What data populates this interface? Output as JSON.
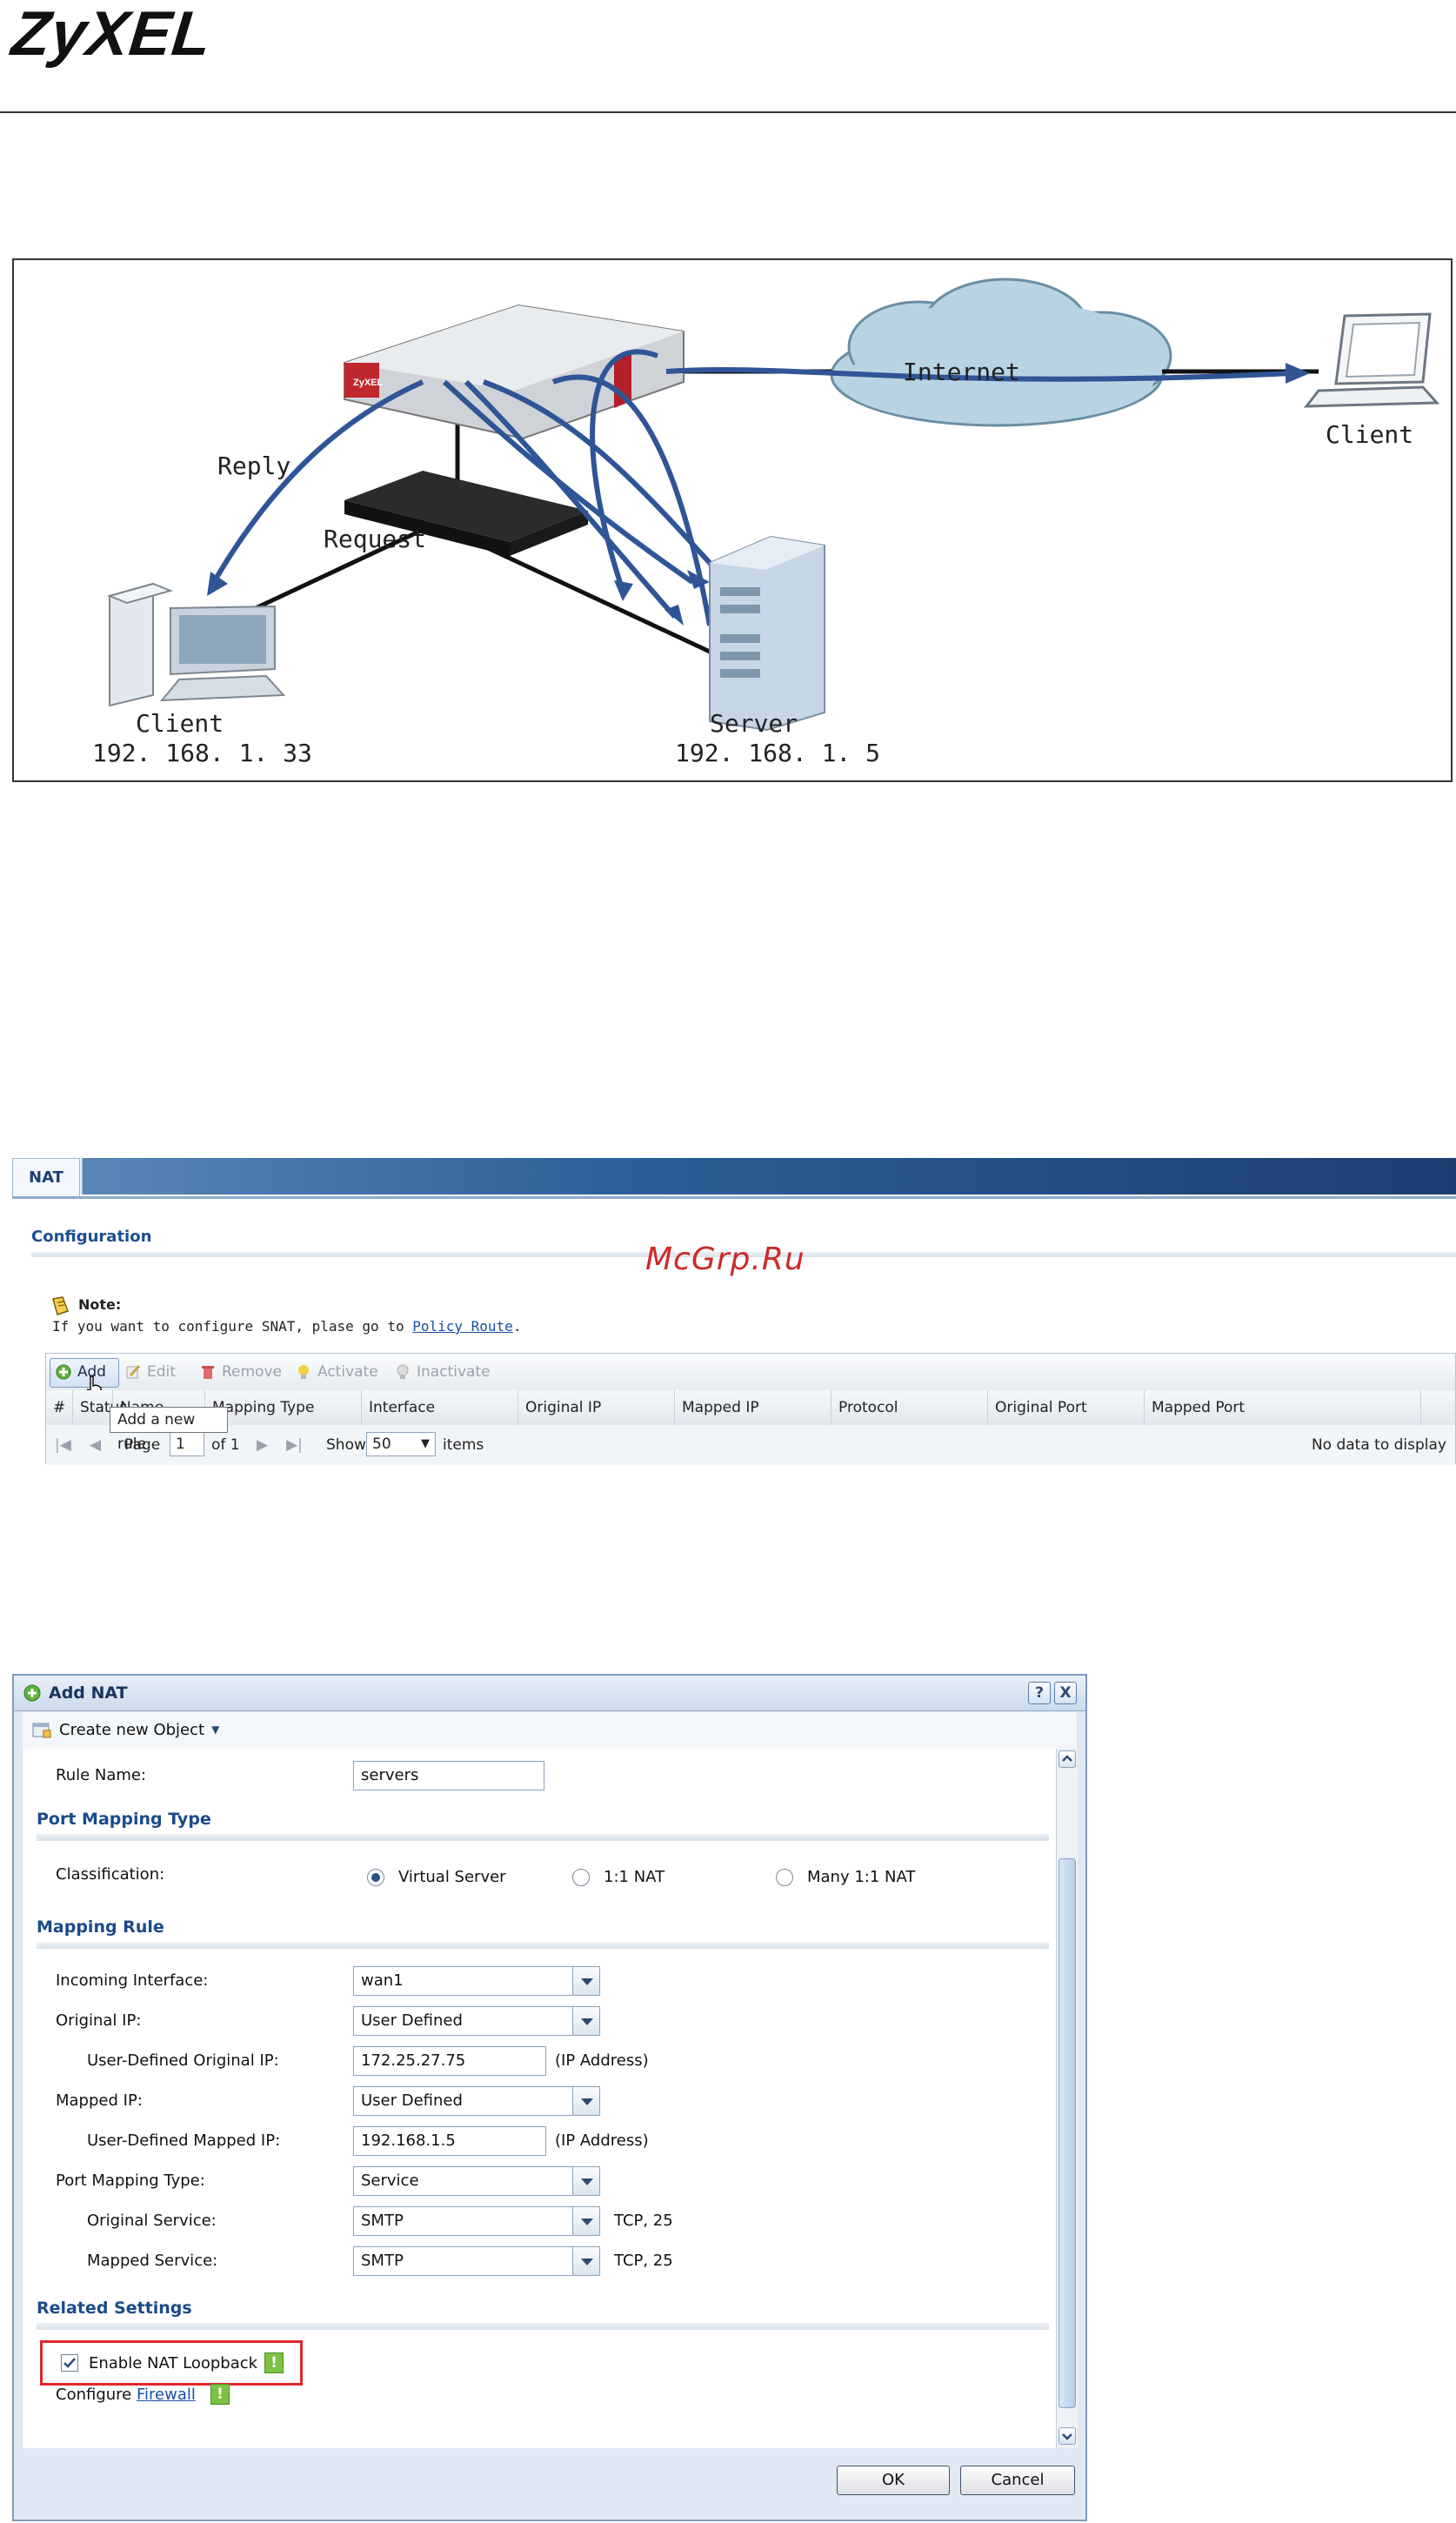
{
  "header": {
    "logo": "ZyXEL"
  },
  "diagram": {
    "labels": {
      "internet": "Internet",
      "remote_client": "Client",
      "reply": "Reply",
      "request": "Request",
      "local_client": "Client",
      "local_client_ip": "192. 168. 1. 33",
      "server": "Server",
      "server_ip": "192. 168. 1. 5"
    }
  },
  "watermark": "McGrp.Ru",
  "nat_panel": {
    "tab": "NAT",
    "section": "Configuration",
    "note_title": "Note:",
    "note_text": "If you want to configure SNAT, plase go to ",
    "note_link": "Policy Route",
    "note_end": ".",
    "toolbar": {
      "add": "Add",
      "edit": "Edit",
      "remove": "Remove",
      "activate": "Activate",
      "inactivate": "Inactivate"
    },
    "columns": [
      "#",
      "Status",
      "Name",
      "Mapping Type",
      "Interface",
      "Original IP",
      "Mapped IP",
      "Protocol",
      "Original Port",
      "Mapped Port"
    ],
    "tooltip": "Add a new rule",
    "pager": {
      "page_label": "Page",
      "page": "1",
      "of": "of 1",
      "show": "Show",
      "per_page": "50",
      "items": "items",
      "empty": "No data to display"
    }
  },
  "dialog": {
    "title": "Add NAT",
    "help": "?",
    "close": "X",
    "create_object": "Create new Object",
    "rule_name_label": "Rule Name:",
    "rule_name_value": "servers",
    "sec_port_mapping_type": "Port Mapping Type",
    "classification_label": "Classification:",
    "radio_virtual_server": "Virtual Server",
    "radio_one_to_one": "1:1 NAT",
    "radio_many": "Many 1:1 NAT",
    "sec_mapping_rule": "Mapping Rule",
    "incoming_interface_label": "Incoming Interface:",
    "incoming_interface_value": "wan1",
    "original_ip_label": "Original IP:",
    "original_ip_value": "User Defined",
    "ud_original_ip_label": "User-Defined Original IP:",
    "ud_original_ip_value": "172.25.27.75",
    "ip_address_hint": "(IP Address)",
    "mapped_ip_label": "Mapped IP:",
    "mapped_ip_value": "User Defined",
    "ud_mapped_ip_label": "User-Defined Mapped IP:",
    "ud_mapped_ip_value": "192.168.1.5",
    "port_mapping_type_label": "Port Mapping Type:",
    "port_mapping_type_value": "Service",
    "original_service_label": "Original Service:",
    "original_service_value": "SMTP",
    "original_service_hint": "TCP, 25",
    "mapped_service_label": "Mapped Service:",
    "mapped_service_value": "SMTP",
    "mapped_service_hint": "TCP, 25",
    "sec_related": "Related Settings",
    "loopback_label": "Enable NAT Loopback",
    "configure_label": "Configure ",
    "firewall_link": "Firewall",
    "info_mark": "!",
    "ok": "OK",
    "cancel": "Cancel"
  },
  "colors": {
    "accent": "#1b4a8a",
    "highlight": "#e0262b",
    "cable": "#2f5597"
  }
}
